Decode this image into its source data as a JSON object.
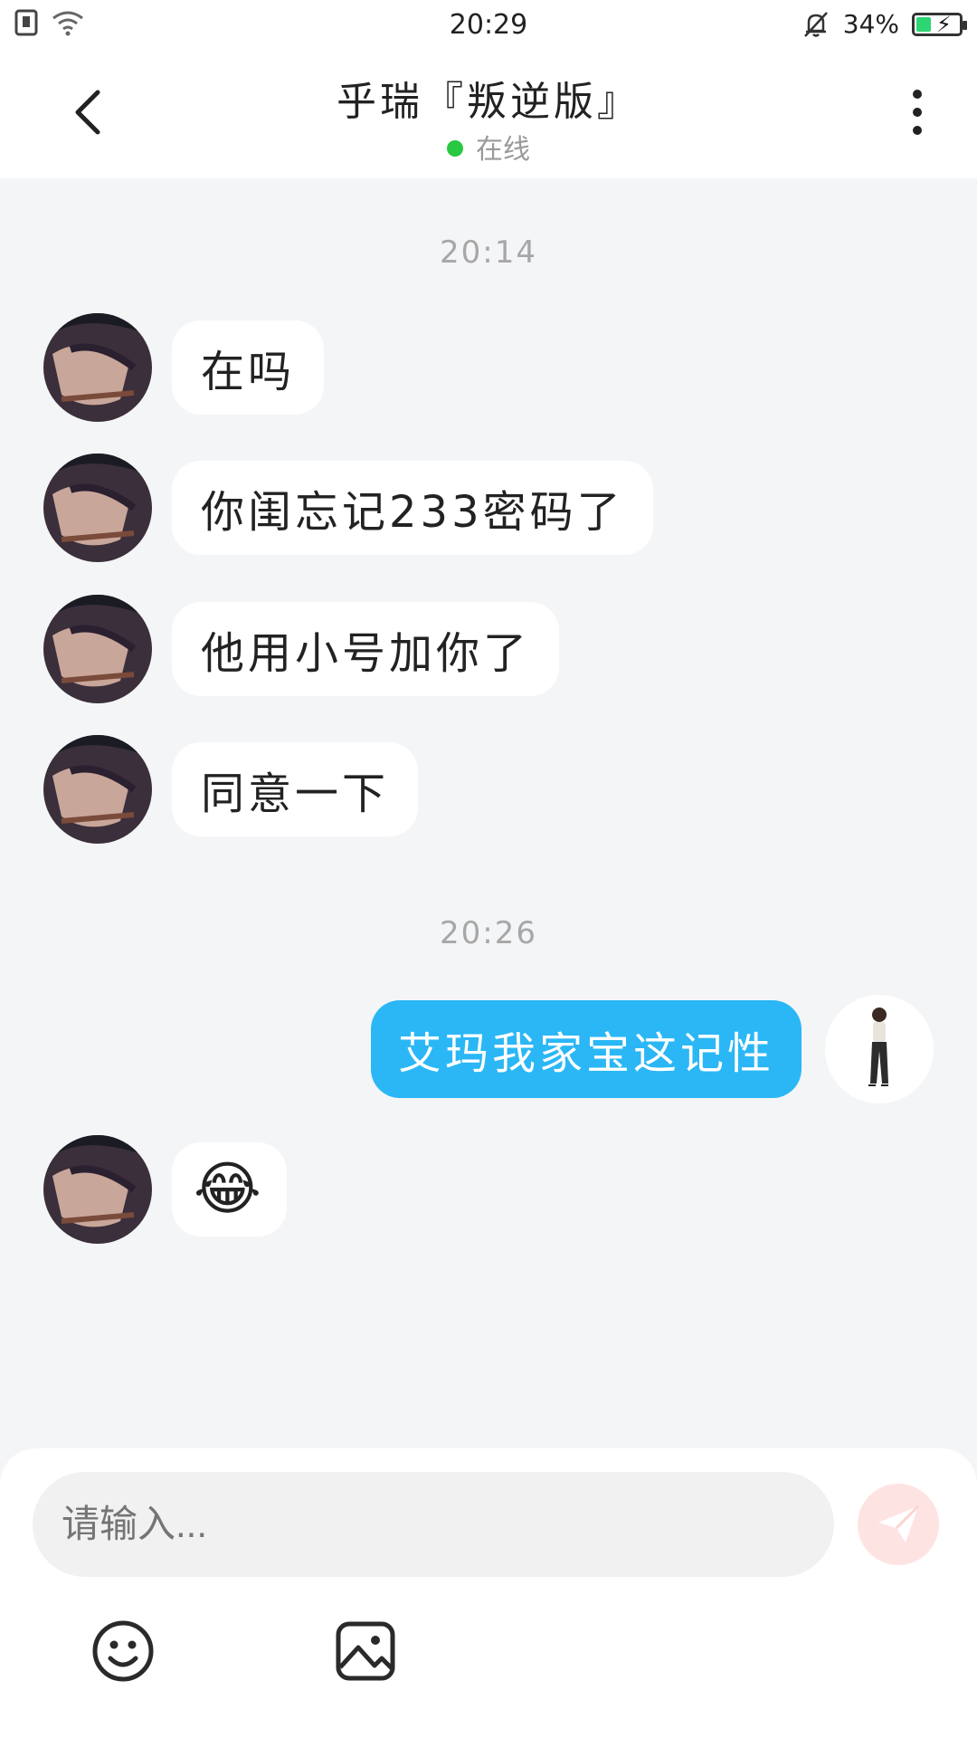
{
  "status_bar": {
    "time": "20:29",
    "battery_percent": "34%",
    "battery_level": 0.34,
    "icons": [
      "sim-icon",
      "wifi-icon",
      "bell-muted-icon",
      "battery-icon"
    ]
  },
  "header": {
    "title": "乎瑞『叛逆版』",
    "status": "在线",
    "status_color": "#28c840",
    "back_icon": "chevron-left-icon",
    "more_icon": "more-vertical-icon"
  },
  "chat": {
    "timestamps": [
      "20:14",
      "20:26"
    ],
    "messages": [
      {
        "side": "left",
        "text": "在吗"
      },
      {
        "side": "left",
        "text": "你闺忘记233密码了"
      },
      {
        "side": "left",
        "text": "他用小号加你了"
      },
      {
        "side": "left",
        "text": "同意一下"
      },
      {
        "side": "right",
        "text": "艾玛我家宝这记性"
      },
      {
        "side": "left",
        "text": "😂"
      }
    ],
    "accent": "#2bb7f5"
  },
  "composer": {
    "placeholder": "请输入...",
    "send_icon": "send-icon",
    "tools": [
      "emoji-icon",
      "image-icon"
    ]
  }
}
